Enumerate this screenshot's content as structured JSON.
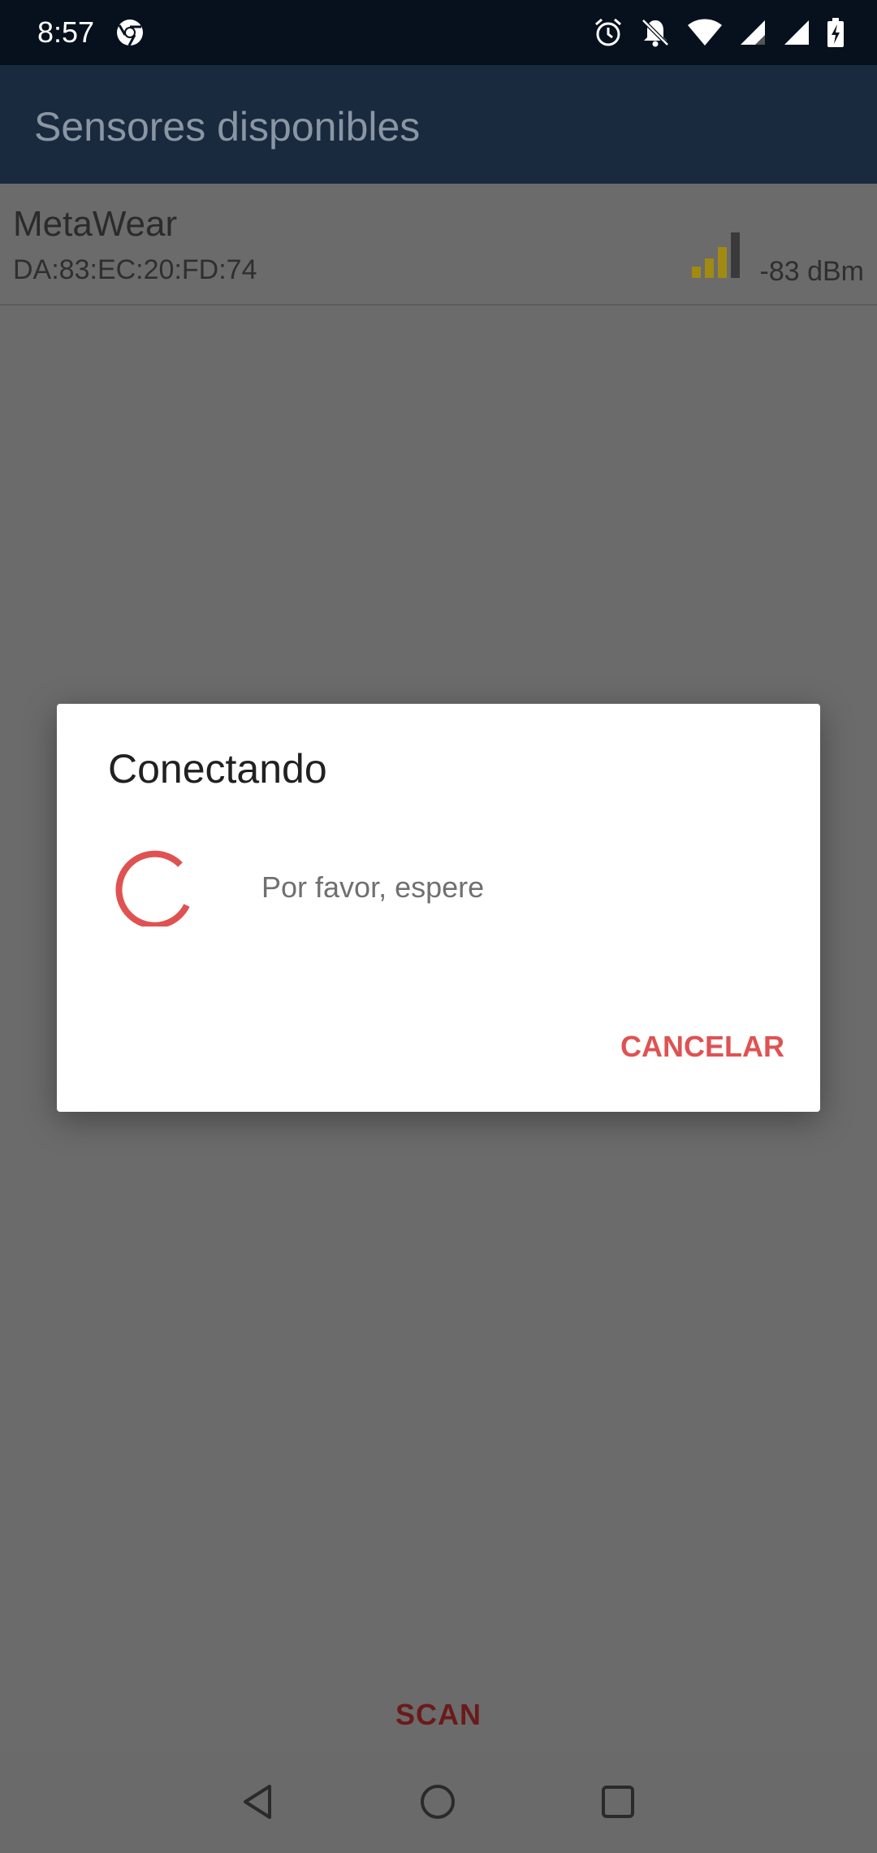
{
  "status_bar": {
    "time": "8:57",
    "icons": [
      "chrome-icon",
      "alarm-icon",
      "notifications-off-icon",
      "wifi-icon",
      "cell-signal-icon",
      "cell-signal-icon",
      "battery-charging-icon"
    ]
  },
  "app_bar": {
    "title": "Sensores disponibles"
  },
  "device_list": [
    {
      "name": "MetaWear",
      "mac": "DA:83:EC:20:FD:74",
      "rssi": "-83 dBm",
      "signal_bars_active": 3,
      "signal_bars_total": 4,
      "signal_active_color": "#a08a12",
      "signal_inactive_color": "#3a3a3a"
    }
  ],
  "scan_button": {
    "label": "SCAN"
  },
  "dialog": {
    "title": "Conectando",
    "message": "Por favor, espere",
    "cancel_label": "CANCELAR",
    "accent_color": "#e05252"
  },
  "nav_bar": {
    "icons": [
      "back-icon",
      "home-icon",
      "recents-icon"
    ]
  }
}
